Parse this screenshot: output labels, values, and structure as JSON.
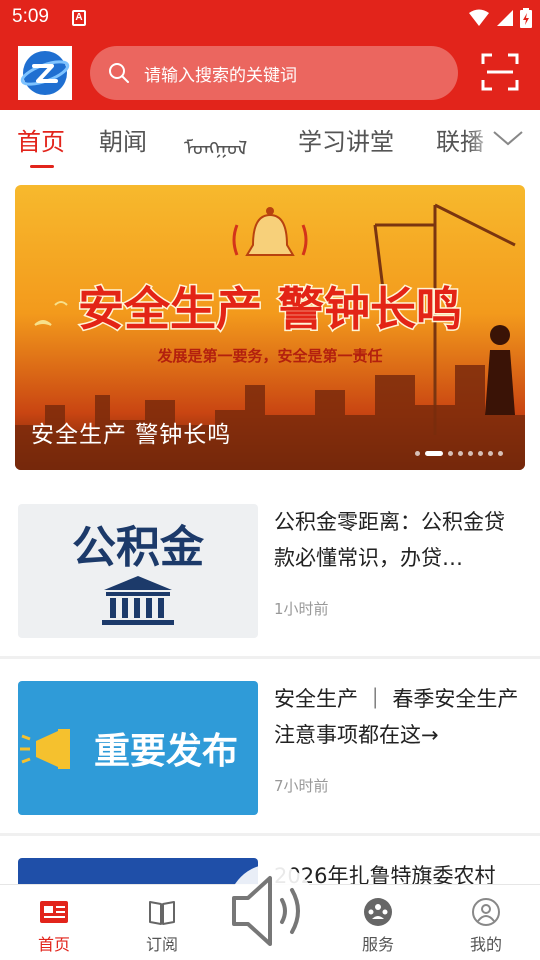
{
  "status_bar": {
    "time": "5:09",
    "notification_letter": "A"
  },
  "header": {
    "search_placeholder": "请输入搜索的关键词"
  },
  "tabs": [
    {
      "label": "首页",
      "active": true
    },
    {
      "label": "朝闻",
      "active": false
    },
    {
      "label": "ᠮᠣᠩᠭᠣᠯ",
      "active": false
    },
    {
      "label": "学习讲堂",
      "active": false
    },
    {
      "label": "联播",
      "active": false
    }
  ],
  "banner": {
    "image_headline": "安全生产 警钟长鸣",
    "image_subline": "发展是第一要务，安全是第一责任",
    "caption": "安全生产  警钟长鸣",
    "slide_count": 8,
    "active_slide": 1
  },
  "news": [
    {
      "title": "公积金零距离：公积金贷款必懂常识，办贷…",
      "time": "1小时前",
      "thumb_text": "公积金"
    },
    {
      "title": "安全生产 ｜ 春季安全生产注意事项都在这→",
      "time": "7小时前",
      "thumb_text": "重要发布"
    },
    {
      "title": "2026年扎鲁特旗委农村",
      "time": ""
    }
  ],
  "bottom_nav": [
    {
      "label": "首页",
      "icon": "news-icon",
      "active": true
    },
    {
      "label": "订阅",
      "icon": "book-icon",
      "active": false
    },
    {
      "label": "",
      "icon": "speaker-icon",
      "active": false
    },
    {
      "label": "服务",
      "icon": "services-icon",
      "active": false
    },
    {
      "label": "我的",
      "icon": "profile-icon",
      "active": false
    }
  ],
  "colors": {
    "brand_red": "#e2241b",
    "muted_text": "#999999",
    "banner_orange": "#f39a1c"
  }
}
